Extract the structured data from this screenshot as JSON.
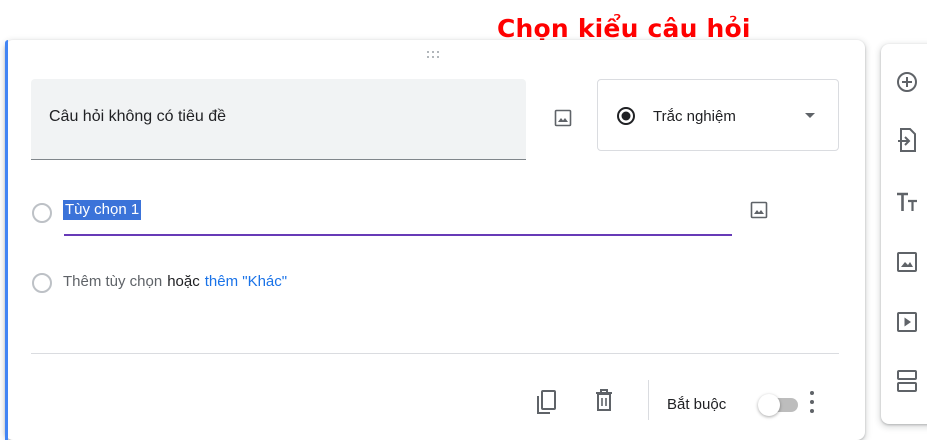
{
  "annotation": {
    "text": "Chọn kiểu câu hỏi",
    "color": "#ff0000"
  },
  "question": {
    "title": "Câu hỏi không có tiêu đề",
    "type_label": "Trắc nghiệm",
    "accent_color": "#4285f4"
  },
  "options": {
    "option1": "Tùy chọn 1",
    "add_option": "Thêm tùy chọn",
    "or": "hoặc",
    "add_other": "thêm \"Khác\""
  },
  "footer": {
    "required_label": "Bắt buộc",
    "required_on": false
  },
  "icons": {
    "drag": "drag-handle-icon",
    "image": "image-icon",
    "radio": "radio-checked-icon",
    "copy": "copy-icon",
    "delete": "trash-icon",
    "more": "more-vert-icon",
    "toolbar": [
      "add-circle-icon",
      "import-icon",
      "title-text-icon",
      "image-icon",
      "video-icon",
      "section-icon"
    ]
  }
}
